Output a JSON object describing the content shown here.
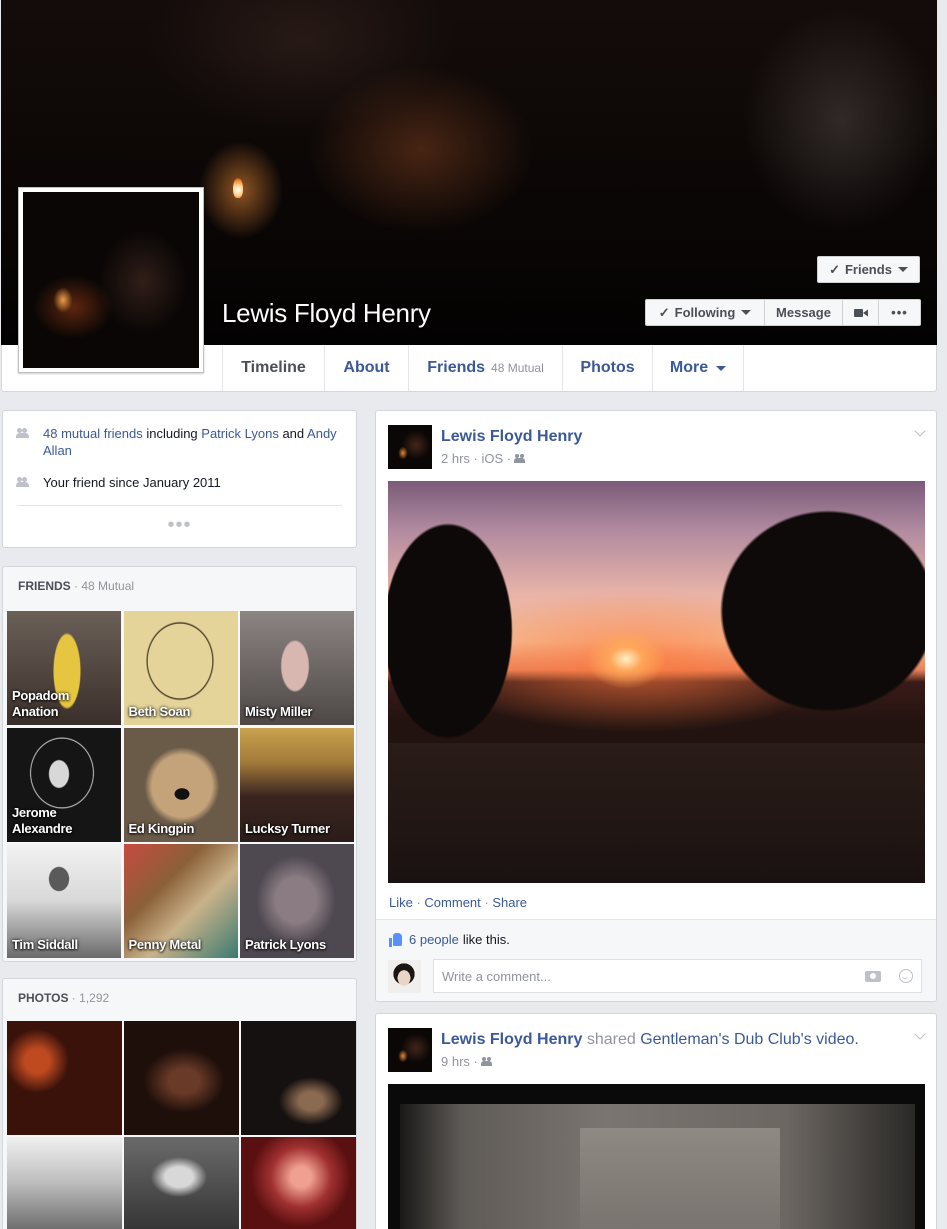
{
  "profile": {
    "name": "Lewis Floyd Henry",
    "friends_button": "Friends",
    "following_button": "Following",
    "message_button": "Message",
    "more_dots": "•••"
  },
  "tabs": [
    {
      "label": "Timeline",
      "sub": ""
    },
    {
      "label": "About",
      "sub": ""
    },
    {
      "label": "Friends",
      "sub": "48 Mutual"
    },
    {
      "label": "Photos",
      "sub": ""
    },
    {
      "label": "More",
      "sub": ""
    }
  ],
  "intro": {
    "mutual_link": "48 mutual friends",
    "including": " including ",
    "friend1": "Patrick Lyons",
    "and": " and ",
    "friend2": "Andy Allan",
    "friend_since": "Your friend since January 2011",
    "more": "•••"
  },
  "friends_section": {
    "title": "FRIENDS",
    "count": " · 48 Mutual",
    "friends": [
      {
        "name": "Popadom Anation"
      },
      {
        "name": "Beth Soan"
      },
      {
        "name": "Misty Miller"
      },
      {
        "name": "Jerome Alexandre"
      },
      {
        "name": "Ed Kingpin"
      },
      {
        "name": "Lucksy Turner"
      },
      {
        "name": "Tim Siddall"
      },
      {
        "name": "Penny Metal"
      },
      {
        "name": "Patrick Lyons"
      }
    ]
  },
  "photos_section": {
    "title": "PHOTOS",
    "count": " · 1,292"
  },
  "post1": {
    "author": "Lewis Floyd Henry",
    "meta": "2 hrs · iOS ·",
    "actions": {
      "like": "Like",
      "comment": "Comment",
      "share": "Share",
      "sep": " · "
    },
    "likers": "6 people",
    "likes_suffix": "like this.",
    "comment_placeholder": "Write a comment..."
  },
  "post2": {
    "author": "Lewis Floyd Henry",
    "shared": " shared ",
    "page": "Gentleman's Dub Club",
    "suffix": "'s video.",
    "meta": "9 hrs ·"
  },
  "colors": {
    "link": "#3b5998",
    "background": "#e9eaed",
    "like_blue": "#5890ff"
  }
}
